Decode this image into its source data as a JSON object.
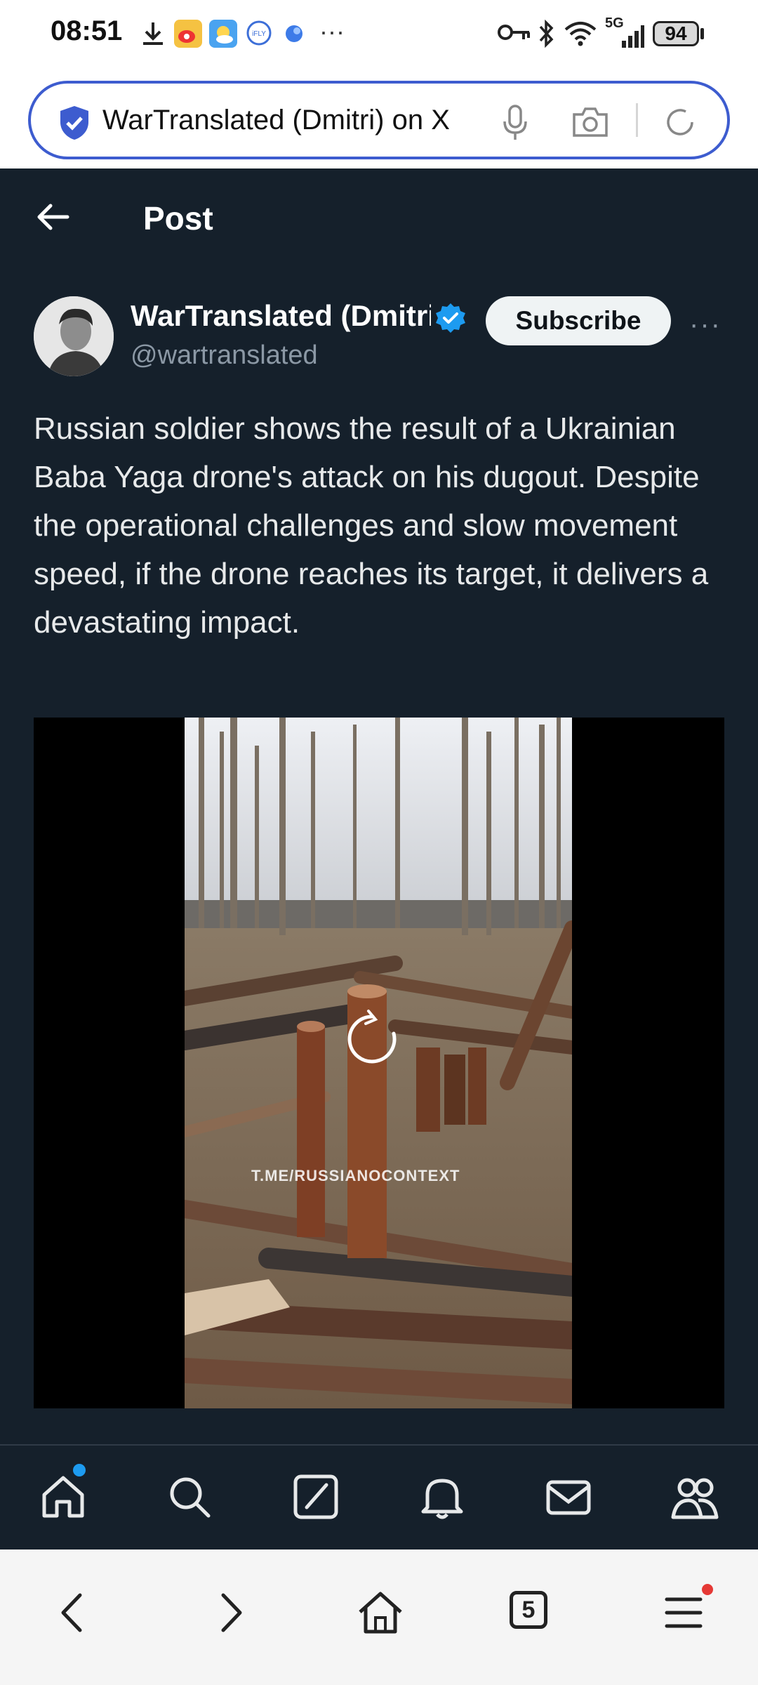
{
  "status_bar": {
    "time": "08:51",
    "network": "5G",
    "battery": "94"
  },
  "browser": {
    "url_text": "WarTranslated (Dmitri) on X"
  },
  "header": {
    "title": "Post"
  },
  "post": {
    "author_name": "WarTranslated (Dmitri)",
    "handle": "@wartranslated",
    "subscribe_label": "Subscribe",
    "more_label": "···",
    "text": "Russian soldier shows the result of a Ukrainian Baba Yaga drone's attack on his dugout. Despite the operational challenges and slow movement speed, if the drone reaches its target, it delivers a devastating impact.",
    "media_watermark": "T.ME/RUSSIANOCONTEXT"
  },
  "bottom_nav": {
    "items": [
      "home-icon",
      "search-icon",
      "grok-icon",
      "notifications-icon",
      "messages-icon",
      "communities-icon"
    ]
  },
  "browser_nav": {
    "tab_count": "5"
  },
  "colors": {
    "background": "#15202b",
    "accent": "#1d9bf0",
    "url_border": "#3d5ccf",
    "menu_dot": "#e53935"
  }
}
